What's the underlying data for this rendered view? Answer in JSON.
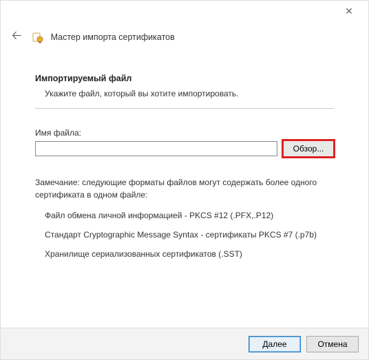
{
  "titlebar": {
    "close_glyph": "✕"
  },
  "header": {
    "back_glyph": "🡠",
    "title": "Мастер импорта сертификатов"
  },
  "section": {
    "heading": "Импортируемый файл",
    "subtext": "Укажите файл, который вы хотите импортировать."
  },
  "file": {
    "label": "Имя файла:",
    "value": "",
    "browse_label": "Обзор..."
  },
  "note": "Замечание: следующие форматы файлов могут содержать более одного сертификата в одном файле:",
  "formats": [
    "Файл обмена личной информацией - PKCS #12 (.PFX,.P12)",
    "Стандарт Cryptographic Message Syntax - сертификаты PKCS #7 (.p7b)",
    "Хранилище сериализованных сертификатов (.SST)"
  ],
  "footer": {
    "next_label": "Далее",
    "cancel_label": "Отмена"
  }
}
